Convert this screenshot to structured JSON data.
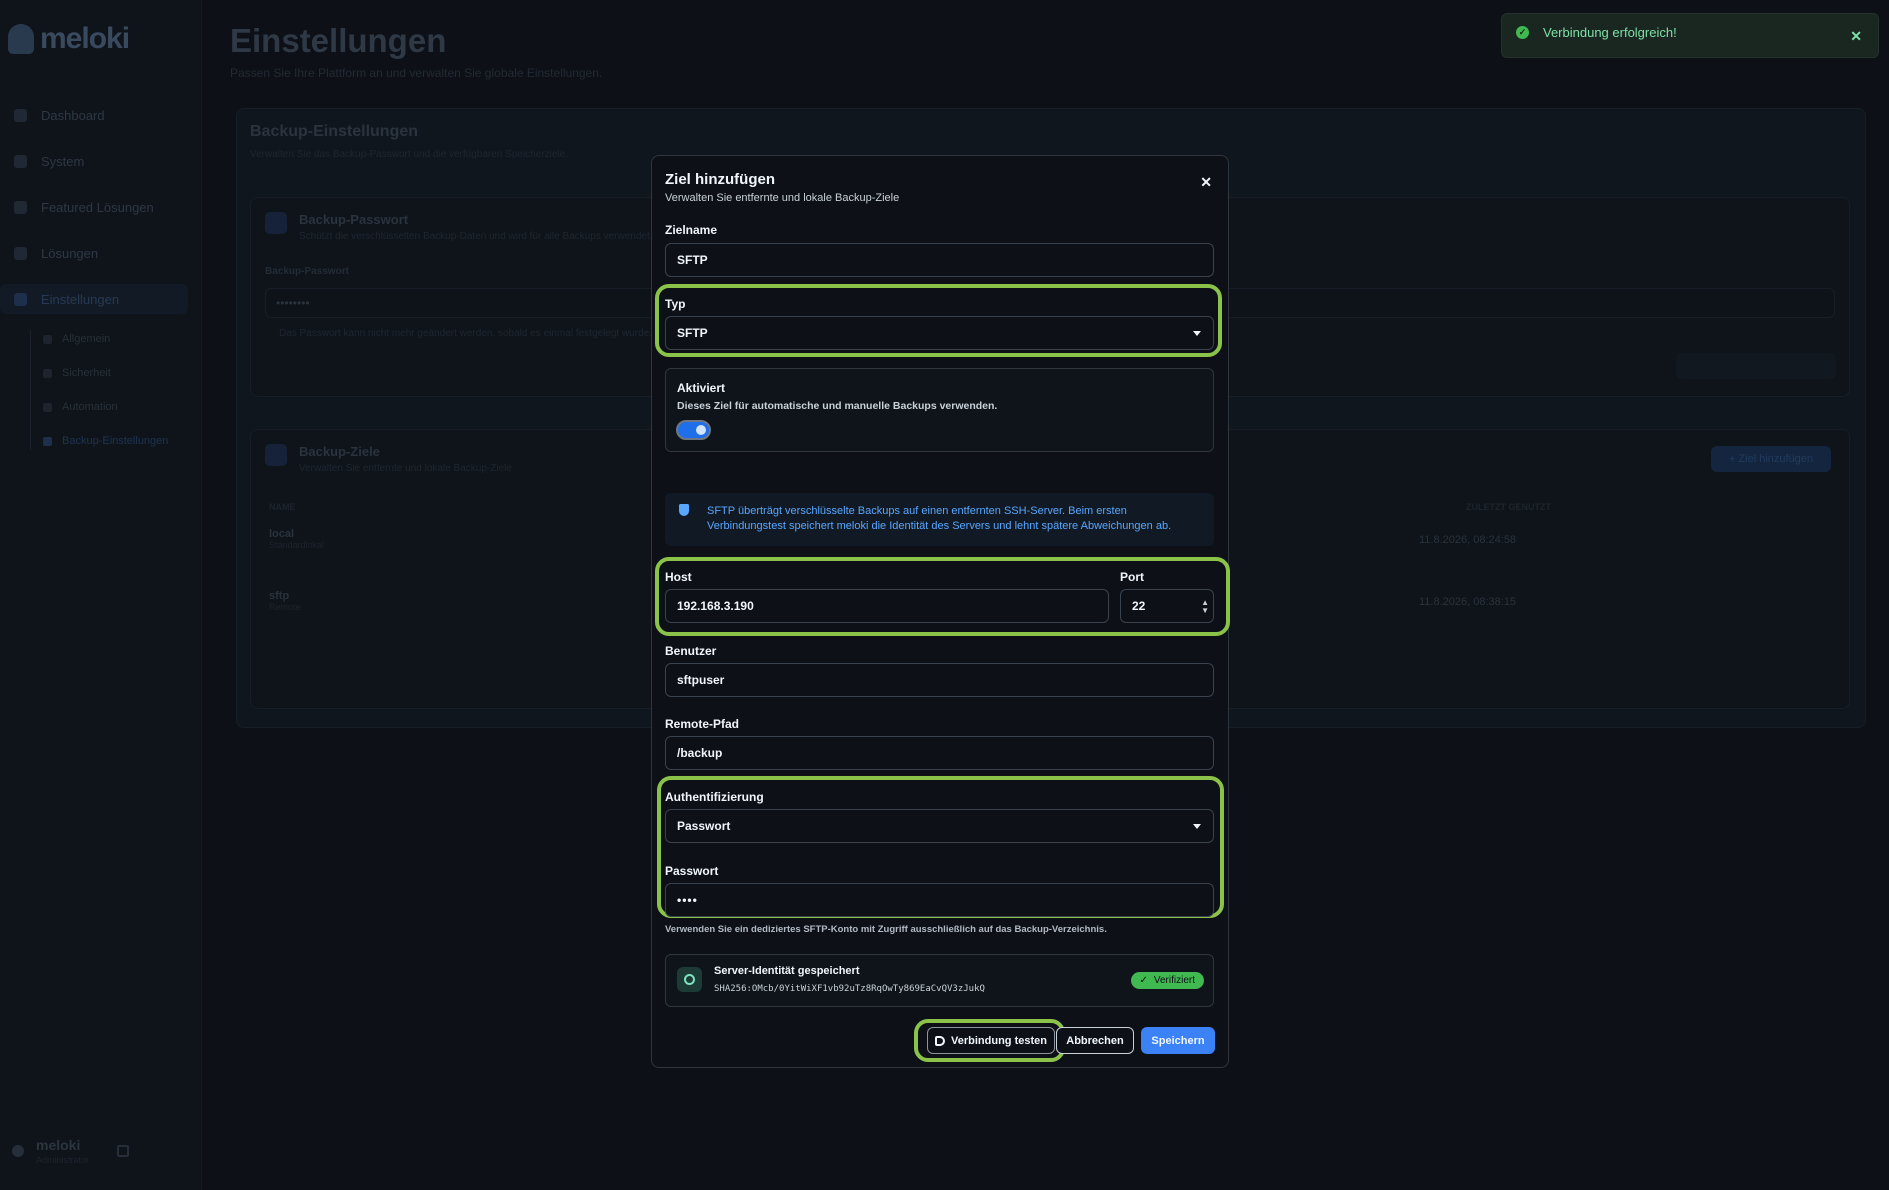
{
  "app": {
    "brand": "meloki",
    "page_title": "Einstellungen",
    "page_subtitle": "Passen Sie Ihre Plattform an und verwalten Sie globale Einstellungen."
  },
  "sidebar": {
    "items": [
      {
        "label": "Dashboard",
        "icon": "chart-icon"
      },
      {
        "label": "System",
        "icon": "gear-icon"
      },
      {
        "label": "Featured Lösungen",
        "icon": "star-icon"
      },
      {
        "label": "Lösungen",
        "icon": "grid-icon"
      },
      {
        "label": "Einstellungen",
        "icon": "settings-icon",
        "active": true
      }
    ],
    "subitems": [
      {
        "label": "Allgemein"
      },
      {
        "label": "Sicherheit"
      },
      {
        "label": "Automation"
      },
      {
        "label": "Backup-Einstellungen",
        "active": true
      }
    ],
    "user": {
      "name": "meloki",
      "role": "Administrator"
    }
  },
  "background": {
    "backup_settings_title": "Backup-Einstellungen",
    "backup_settings_sub": "Verwalten Sie das Backup-Passwort und die verfügbaren Speicherziele.",
    "password_card_title": "Backup-Passwort",
    "password_card_sub": "Schützt die verschlüsselten Backup-Daten und wird für alle Backups verwendet.",
    "password_label": "Backup-Passwort",
    "password_value": "••••••••",
    "password_note": "Das Passwort kann nicht mehr geändert werden, sobald es einmal festgelegt wurde.",
    "targets_title": "Backup-Ziele",
    "targets_sub": "Verwalten Sie entfernte und lokale Backup-Ziele",
    "add_target": "+ Ziel hinzufügen",
    "col_name": "NAME",
    "col_last_used": "ZULETZT GENUTZT",
    "rows": [
      {
        "name": "local",
        "sub": "Standardlokal",
        "date": "11.8.2026, 08:24:58"
      },
      {
        "name": "sftp",
        "sub": "Remote",
        "date": "11.8.2026, 08:38:15"
      }
    ]
  },
  "toast": {
    "message": "Verbindung erfolgreich!",
    "color": "#3fb950"
  },
  "modal": {
    "title": "Ziel hinzufügen",
    "subtitle": "Verwalten Sie entfernte und lokale Backup-Ziele",
    "fields": {
      "name_label": "Zielname",
      "name_value": "SFTP",
      "type_label": "Typ",
      "type_value": "SFTP",
      "enabled_label": "Aktiviert",
      "enabled_desc": "Dieses Ziel für automatische und manuelle Backups verwenden.",
      "enabled": true,
      "info_text": "SFTP überträgt verschlüsselte Backups auf einen entfernten SSH-Server. Beim ersten Verbindungstest speichert meloki die Identität des Servers und lehnt spätere Abweichungen ab.",
      "host_label": "Host",
      "host_value": "192.168.3.190",
      "port_label": "Port",
      "port_value": "22",
      "user_label": "Benutzer",
      "user_value": "sftpuser",
      "path_label": "Remote-Pfad",
      "path_value": "/backup",
      "auth_label": "Authentifizierung",
      "auth_value": "Passwort",
      "password_label": "Passwort",
      "password_value": "••••",
      "hint": "Verwenden Sie ein dediziertes SFTP-Konto mit Zugriff ausschließlich auf das Backup-Verzeichnis."
    },
    "identity": {
      "title": "Server-Identität gespeichert",
      "fingerprint": "SHA256:OMcb/0YitWiXF1vb92uTz8RqOwTy869EaCvQV3zJukQ",
      "badge": "Verifiziert"
    },
    "buttons": {
      "test": "Verbindung testen",
      "cancel": "Abbrechen",
      "save": "Speichern"
    },
    "highlight_color": "#8bc34a",
    "accent": "#3b82f6"
  }
}
